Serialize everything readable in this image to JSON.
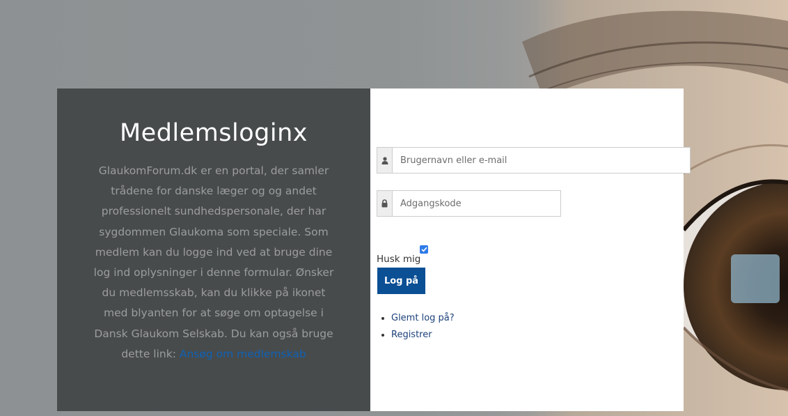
{
  "intro": {
    "title": "Medlemsloginx",
    "description": "GlaukomForum.dk er en portal, der samler trådene for danske læger og og andet professionelt sundhedspersonale, der har sygdommen Glaukoma som speciale. Som medlem kan du logge ind ved at bruge dine log ind oplysninger i denne formular. Ønsker du medlemsskab, kan du klikke på ikonet med blyanten for at søge om optagelse i Dansk Glaukom Selskab. Du kan også bruge dette link: ",
    "link_text": "Ansøg om medlemskab"
  },
  "form": {
    "username_placeholder": "Brugernavn eller e-mail",
    "username_value": "",
    "password_placeholder": "Adgangskode",
    "password_value": "",
    "remember_label": "Husk mig",
    "remember_checked": true,
    "login_button": "Log på"
  },
  "links": [
    {
      "label": "Glemt log på?"
    },
    {
      "label": "Registrer"
    }
  ],
  "colors": {
    "left_panel": "#484b4c",
    "button": "#0b4f94",
    "link": "#0f62b5",
    "checkbox": "#2f7be8"
  },
  "icons": {
    "username": "user-icon",
    "password": "lock-icon",
    "checkbox": "checkmark-icon"
  }
}
